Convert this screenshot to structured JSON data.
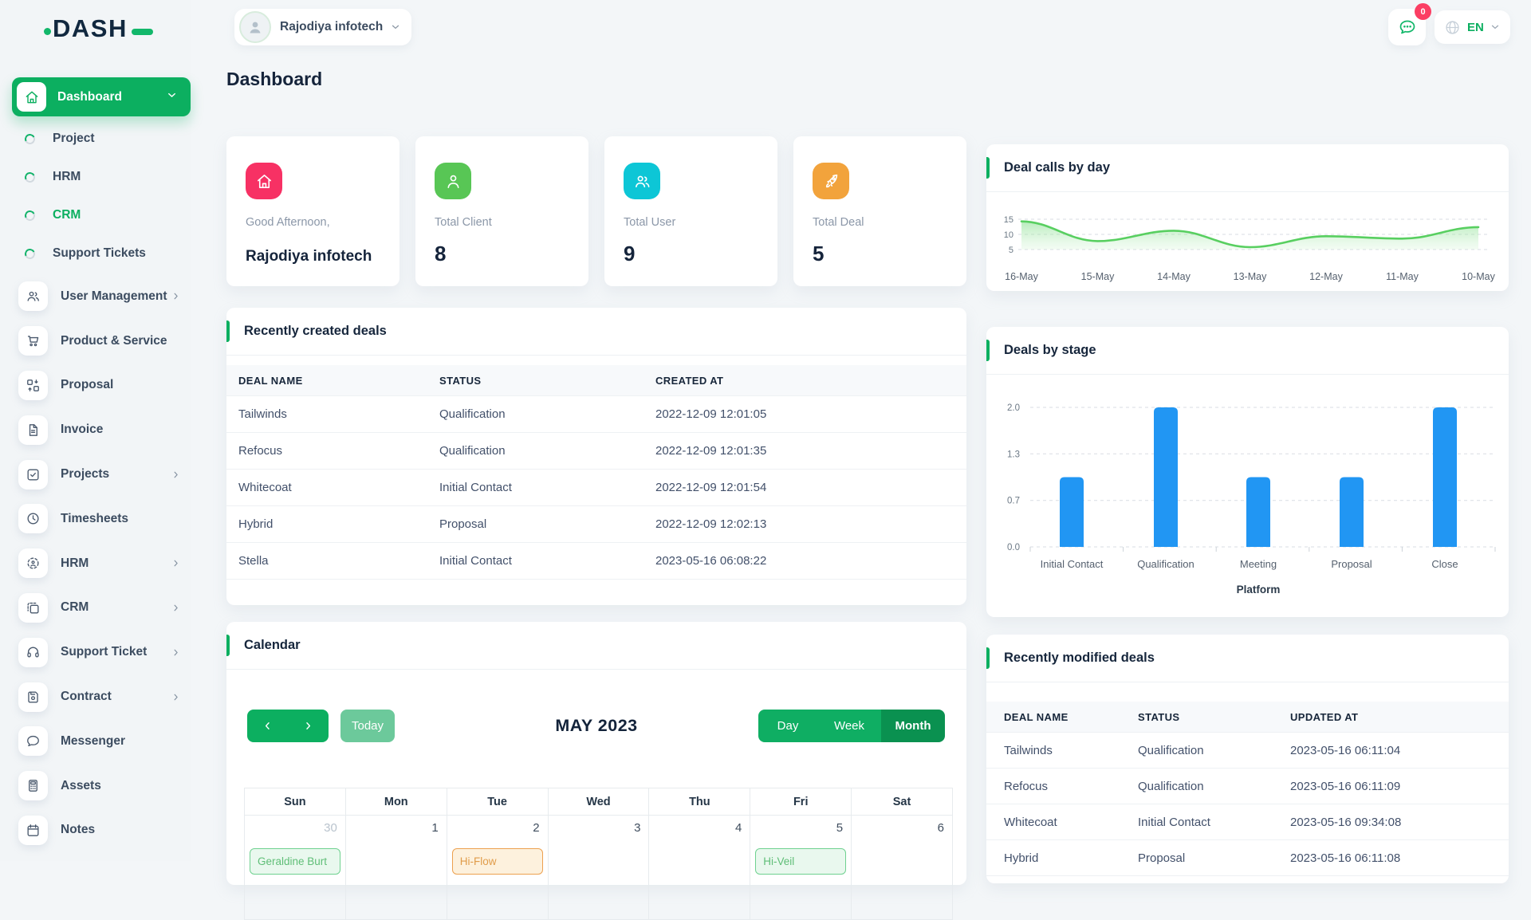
{
  "logo": {
    "text": "DASH"
  },
  "header": {
    "company": "Rajodiya infotech",
    "messages_badge": "0",
    "language": "EN"
  },
  "page": {
    "title": "Dashboard"
  },
  "sidebar": {
    "dashboard_label": "Dashboard",
    "sub_items": [
      {
        "label": "Project",
        "active": false
      },
      {
        "label": "HRM",
        "active": false
      },
      {
        "label": "CRM",
        "active": true
      },
      {
        "label": "Support Tickets",
        "active": false
      }
    ],
    "items": [
      {
        "label": "User Management",
        "icon": "users-icon",
        "chevron": true
      },
      {
        "label": "Product & Service",
        "icon": "cart-icon",
        "chevron": false
      },
      {
        "label": "Proposal",
        "icon": "workflow-icon",
        "chevron": false
      },
      {
        "label": "Invoice",
        "icon": "invoice-icon",
        "chevron": false
      },
      {
        "label": "Projects",
        "icon": "check-square-icon",
        "chevron": true
      },
      {
        "label": "Timesheets",
        "icon": "clock-icon",
        "chevron": false
      },
      {
        "label": "HRM",
        "icon": "target-icon",
        "chevron": true
      },
      {
        "label": "CRM",
        "icon": "copy-icon",
        "chevron": true
      },
      {
        "label": "Support Ticket",
        "icon": "headset-icon",
        "chevron": true
      },
      {
        "label": "Contract",
        "icon": "save-icon",
        "chevron": true
      },
      {
        "label": "Messenger",
        "icon": "chat-icon",
        "chevron": false
      },
      {
        "label": "Assets",
        "icon": "calculator-icon",
        "chevron": false
      },
      {
        "label": "Notes",
        "icon": "calendar-icon",
        "chevron": false
      }
    ]
  },
  "stat_cards": [
    {
      "label": "Good Afternoon,",
      "value": "Rajodiya infotech",
      "icon": "home-icon",
      "color": "#f73164",
      "name_style": true
    },
    {
      "label": "Total Client",
      "value": "8",
      "icon": "user-icon",
      "color": "#58c655",
      "name_style": false
    },
    {
      "label": "Total User",
      "value": "9",
      "icon": "users-icon",
      "color": "#0dc6d6",
      "name_style": false
    },
    {
      "label": "Total Deal",
      "value": "5",
      "icon": "rocket-icon",
      "color": "#f2a33c",
      "name_style": false
    }
  ],
  "recently_created": {
    "title": "Recently created deals",
    "columns": [
      "DEAL NAME",
      "STATUS",
      "CREATED AT"
    ],
    "rows": [
      [
        "Tailwinds",
        "Qualification",
        "2022-12-09 12:01:05"
      ],
      [
        "Refocus",
        "Qualification",
        "2022-12-09 12:01:35"
      ],
      [
        "Whitecoat",
        "Initial Contact",
        "2022-12-09 12:01:54"
      ],
      [
        "Hybrid",
        "Proposal",
        "2022-12-09 12:02:13"
      ],
      [
        "Stella",
        "Initial Contact",
        "2023-05-16 06:08:22"
      ]
    ]
  },
  "recently_modified": {
    "title": "Recently modified deals",
    "columns": [
      "DEAL NAME",
      "STATUS",
      "UPDATED AT"
    ],
    "rows": [
      [
        "Tailwinds",
        "Qualification",
        "2023-05-16 06:11:04"
      ],
      [
        "Refocus",
        "Qualification",
        "2023-05-16 06:11:09"
      ],
      [
        "Whitecoat",
        "Initial Contact",
        "2023-05-16 09:34:08"
      ],
      [
        "Hybrid",
        "Proposal",
        "2023-05-16 06:11:08"
      ]
    ]
  },
  "calendar": {
    "title": "Calendar",
    "today_label": "Today",
    "month_title": "MAY 2023",
    "views": [
      "Day",
      "Week",
      "Month"
    ],
    "active_view": "Month",
    "day_headers": [
      "Sun",
      "Mon",
      "Tue",
      "Wed",
      "Thu",
      "Fri",
      "Sat"
    ],
    "visible_week": {
      "dates": [
        "30",
        "1",
        "2",
        "3",
        "4",
        "5",
        "6"
      ],
      "muted": [
        0
      ],
      "events": [
        {
          "day": 0,
          "label": "Geraldine Burt",
          "color": "green"
        },
        {
          "day": 2,
          "label": "Hi-Flow",
          "color": "orange"
        },
        {
          "day": 5,
          "label": "Hi-Veil",
          "color": "green"
        }
      ]
    }
  },
  "chart_data": [
    {
      "type": "line",
      "title": "Deal calls by day",
      "x": [
        "16-May",
        "15-May",
        "14-May",
        "13-May",
        "12-May",
        "11-May",
        "10-May"
      ],
      "series": [
        {
          "name": "Deal calls",
          "values": [
            14.3,
            7.8,
            11.2,
            5.8,
            9.4,
            8.6,
            12.4
          ]
        }
      ],
      "yticks": [
        5,
        10,
        15
      ],
      "ylim": [
        4,
        16
      ],
      "grid": "dashed-horizontal",
      "legend": "none",
      "style": "smooth-area",
      "line_color": "#58cf60"
    },
    {
      "type": "bar",
      "title": "Deals by stage",
      "categories": [
        "Initial Contact",
        "Qualification",
        "Meeting",
        "Proposal",
        "Close"
      ],
      "values": [
        1,
        2,
        1,
        1,
        2
      ],
      "ytick_labels": [
        "0.0",
        "0.7",
        "1.3",
        "2.0"
      ],
      "ylim": [
        0,
        2
      ],
      "xlabel": "Platform",
      "grid": "dashed-horizontal",
      "legend": "none",
      "bar_color": "#2196f3"
    }
  ],
  "colors": {
    "primary_green": "#0caf60",
    "dark_green": "#0a9150",
    "light_green_button": "#6cc99b",
    "badge_pink": "#fb3e63",
    "bar_blue": "#2196f3",
    "line_green": "#58cf60",
    "event_green": "#5fbe77",
    "event_orange": "#e09c4a"
  }
}
